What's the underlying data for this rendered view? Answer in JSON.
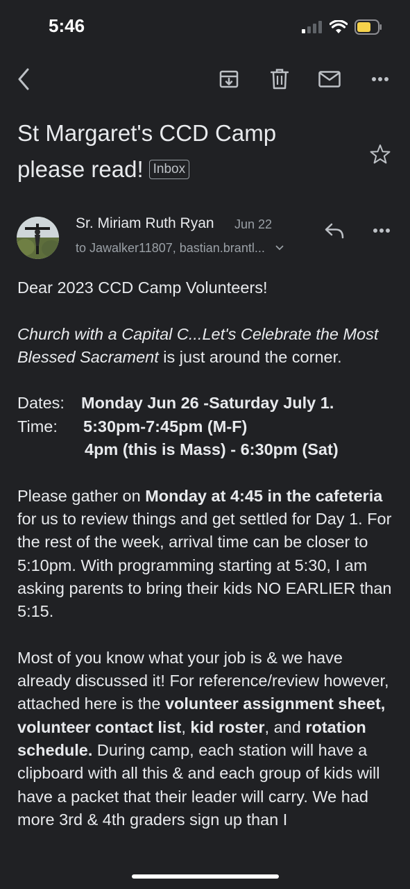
{
  "status_bar": {
    "time": "5:46"
  },
  "toolbar": {
    "icons": [
      "back-arrow-icon",
      "archive-icon",
      "trash-icon",
      "mail-icon",
      "more-icon"
    ]
  },
  "email": {
    "subject_line1": "St Margaret's CCD Camp",
    "subject_line2": "please read!",
    "label_chip": "Inbox",
    "sender": "Sr. Miriam Ruth Ryan",
    "date": "Jun 22",
    "recipients": "to Jawalker11807, bastian.brantl...",
    "greeting": "Dear 2023 CCD Camp Volunteers!",
    "theme_italic": "Church with a Capital C...Let's Celebrate the Most Blessed Sacrament",
    "theme_rest": " is just around the corner.",
    "dates_label": "Dates:",
    "dates_value": "Monday Jun 26 -Saturday July 1.",
    "time_label": "Time:",
    "time_value1": "5:30pm-7:45pm (M-F)",
    "time_value2": "4pm (this is Mass) - 6:30pm (Sat)",
    "para1_a": "Please gather on ",
    "para1_bold": "Monday at 4:45 in the cafeteria",
    "para1_b": " for us to review things and get settled for Day 1. For the rest of the week, arrival time can be closer to 5:10pm. With programming starting at 5:30, I am asking parents to bring their kids NO EARLIER than 5:15.",
    "para2_a": "Most of you know what your job is & we have already discussed it! For reference/review however, attached here is the ",
    "para2_b1": "volunteer assignment sheet, volunteer contact list",
    "para2_c": ", ",
    "para2_b2": "kid roster",
    "para2_d": ", and ",
    "para2_b3": "rotation schedule.",
    "para2_e": " During camp, each station will have a clipboard with all this & and each group of kids will have a packet that their leader will carry. We had",
    "para2_cut": "more 3rd & 4th graders sign up than I"
  },
  "colors": {
    "background": "#202124",
    "text": "#e8eaed",
    "muted": "#9aa0a6",
    "battery": "#f6d24b"
  }
}
